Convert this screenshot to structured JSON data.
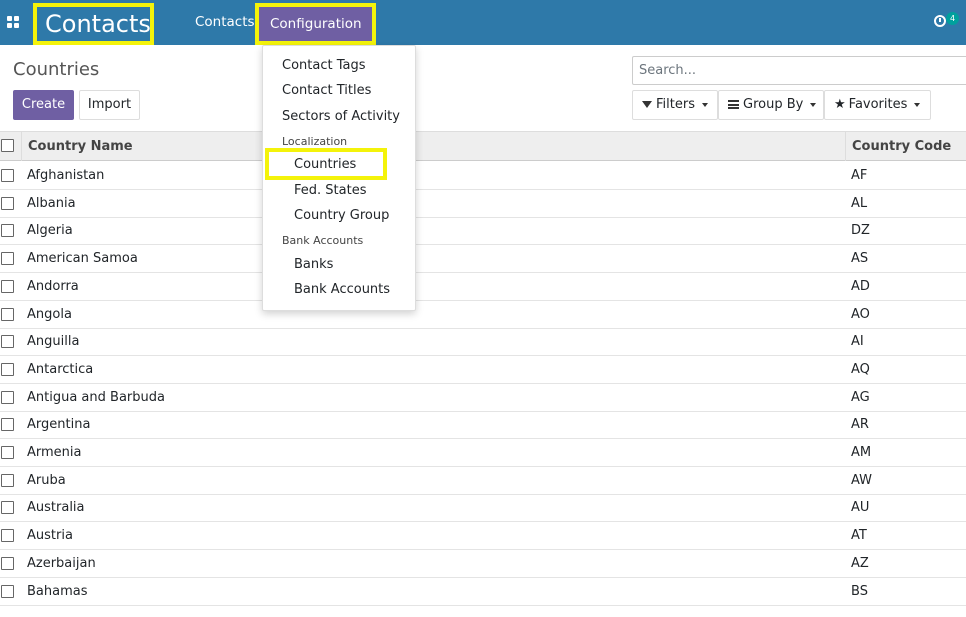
{
  "navbar": {
    "app_name": "Contacts",
    "menu_contacts": "Contacts",
    "menu_configuration": "Configuration",
    "activity_count": "4"
  },
  "control_panel": {
    "breadcrumb": "Countries",
    "create_label": "Create",
    "import_label": "Import",
    "search_placeholder": "Search...",
    "filters_label": "Filters",
    "group_by_label": "Group By",
    "favorites_label": "Favorites"
  },
  "dropdown": {
    "items": [
      {
        "label": "Contact Tags"
      },
      {
        "label": "Contact Titles"
      },
      {
        "label": "Sectors of Activity"
      },
      {
        "header": "Localization"
      },
      {
        "label": "Countries"
      },
      {
        "label": "Fed. States"
      },
      {
        "label": "Country Group"
      },
      {
        "header": "Bank Accounts"
      },
      {
        "label": "Banks"
      },
      {
        "label": "Bank Accounts"
      }
    ]
  },
  "table": {
    "columns": [
      "Country Name",
      "Country Code"
    ],
    "rows": [
      {
        "name": "Afghanistan",
        "code": "AF"
      },
      {
        "name": "Albania",
        "code": "AL"
      },
      {
        "name": "Algeria",
        "code": "DZ"
      },
      {
        "name": "American Samoa",
        "code": "AS"
      },
      {
        "name": "Andorra",
        "code": "AD"
      },
      {
        "name": "Angola",
        "code": "AO"
      },
      {
        "name": "Anguilla",
        "code": "AI"
      },
      {
        "name": "Antarctica",
        "code": "AQ"
      },
      {
        "name": "Antigua and Barbuda",
        "code": "AG"
      },
      {
        "name": "Argentina",
        "code": "AR"
      },
      {
        "name": "Armenia",
        "code": "AM"
      },
      {
        "name": "Aruba",
        "code": "AW"
      },
      {
        "name": "Australia",
        "code": "AU"
      },
      {
        "name": "Austria",
        "code": "AT"
      },
      {
        "name": "Azerbaijan",
        "code": "AZ"
      },
      {
        "name": "Bahamas",
        "code": "BS"
      }
    ]
  },
  "colors": {
    "navbar": "#2e79a9",
    "primary": "#6f5fa3",
    "highlight": "#f4f30a"
  }
}
